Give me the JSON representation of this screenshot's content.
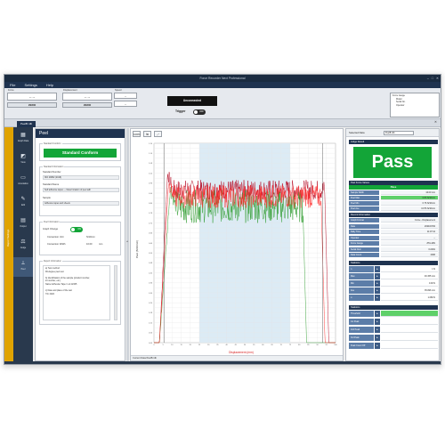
{
  "window": {
    "title": "Force Recorder Next Professional",
    "min": "–",
    "max": "□",
    "close": "✕"
  },
  "menu": [
    "File",
    "Settings",
    "Help"
  ],
  "ribbon": {
    "force": {
      "label": "Force",
      "value": "-- --",
      "zero": "ZERO"
    },
    "displacement": {
      "label": "Displacement",
      "value": "-- --",
      "zero": "ZERO"
    },
    "speed": {
      "label": "Speed",
      "value": "--",
      "unit": "--"
    },
    "connection": "Unconnected",
    "trigger": {
      "label": "Trigger",
      "state": "OFF"
    },
    "right_box": [
      "Force Gauge",
      "Model",
      "Serial No.",
      "Operator"
    ]
  },
  "tab": {
    "label": "PeelB.rdb",
    "close": "✕"
  },
  "leftbar_text": "Report Settings",
  "nav": [
    {
      "icon": "graph-data-icon",
      "glyph": "▦",
      "label": "Graph Data"
    },
    {
      "icon": "view-icon",
      "glyph": "◩",
      "label": "View"
    },
    {
      "icon": "annotation-icon",
      "glyph": "▭",
      "label": "Annotation"
    },
    {
      "icon": "edit-icon",
      "glyph": "✎",
      "label": "Edit"
    },
    {
      "icon": "output-icon",
      "glyph": "▤",
      "label": "Output"
    },
    {
      "icon": "judge-icon",
      "glyph": "⚖",
      "label": "Judge"
    },
    {
      "icon": "peel-icon",
      "glyph": "⟂",
      "label": "Peel"
    }
  ],
  "peel_panel": {
    "title": "Peel",
    "standard_conform": {
      "section": "Standard Conform",
      "button": "Standard Conform"
    },
    "standard_info": {
      "section": "Standard Information",
      "number_label": "Standard Number",
      "number_value": "ISO 29862 (2018)",
      "name_label": "Standard Name",
      "name_value": "Self adhesive tapes — Determination of peel adh",
      "sample_label": "Sample",
      "sample_value": "Adhesive tapes and sheets"
    },
    "peel_info": {
      "section": "Peel Information",
      "graph_change": "Graph Change",
      "graph_toggle": "ON",
      "conversion_unit_label": "Conversion Unit",
      "conversion_unit_value": "N/10mm",
      "conversion_width_label": "Conversion Width",
      "conversion_width_value": "10.00",
      "conversion_width_unit": "mm"
    },
    "report_info": {
      "section": "Report Information",
      "lines": [
        "a) Test method",
        "90-degree peel test",
        "",
        "b) Identification of the sample (product number,",
        "lot number, etc.)",
        "Name:Adhesive Tape / Lot:12345",
        "",
        "c) Date and place of the test",
        "7/1/ 2024"
      ]
    }
  },
  "chart_toolbar": [
    "100%",
    "⇆",
    "⤢"
  ],
  "chart_status": "Current Data:PeelB.rdb",
  "chart_data": {
    "type": "line",
    "title": "",
    "xlabel": "Displacement (mm)",
    "ylabel": "Peel (N/10mm)",
    "xlim": [
      0,
      100
    ],
    "ylim": [
      0,
      1.2
    ],
    "grid": true,
    "shaded_region": [
      25,
      75
    ],
    "cursor_x": [
      5.5,
      93
    ],
    "series": [
      {
        "color": "#b3001b",
        "role": "dark-red",
        "start": 3,
        "rise": 7.5,
        "peak": 1.02,
        "plateau": 0.92,
        "noise": 0.06,
        "end": 94
      },
      {
        "color": "#2a9a2a",
        "role": "green",
        "start": 3,
        "rise": 9,
        "peak": 0.93,
        "plateau": 0.82,
        "noise": 0.1,
        "end": 82
      },
      {
        "color": "#ff2a2a",
        "role": "red",
        "start": 3,
        "rise": 8,
        "peak": 0.96,
        "plateau": 0.88,
        "noise": 0.07,
        "end": 92
      }
    ]
  },
  "results": {
    "selected_data_label": "Selected Data",
    "selected_data_value": "PeelB.rdb",
    "judge_section": "Judge Result",
    "judge": "Pass",
    "peel_section": "Peel Force Values",
    "peel_status": "Pass",
    "peel_rows": [
      {
        "k": "Sample Width",
        "v": "10.00 mm",
        "green": false
      },
      {
        "k": "Peel Max",
        "v": "0.83 N/10mm",
        "green": true
      },
      {
        "k": "Peel Min",
        "v": "0.76 N/10mm",
        "green": false
      },
      {
        "k": "Peel Ave",
        "v": "0.076 N/10mm",
        "green": false
      }
    ],
    "record_section": "Record Information",
    "record_rows": [
      {
        "k": "Graph Format",
        "v": "Force - Displacement"
      },
      {
        "k": "Date",
        "v": "2024/07/02"
      },
      {
        "k": "Daily Time",
        "v": "11:07:41"
      },
      {
        "k": "Operator",
        "v": "--"
      },
      {
        "k": "Force Gauge",
        "v": "ZTA-20N"
      },
      {
        "k": "Serial Num",
        "v": "0-0001"
      },
      {
        "k": "Data Count",
        "v": "2006"
      }
    ],
    "stats_section": "Statistics",
    "stats_rows": [
      {
        "k": "n",
        "v": "1 N"
      },
      {
        "k": "Max",
        "v": "46.155 mm"
      },
      {
        "k": "Min",
        "v": "0.00 N"
      },
      {
        "k": "Ave",
        "v": "35.096 mm"
      },
      {
        "k": "σ",
        "v": "1.080 N"
      }
    ],
    "stats2_section": "Statistics",
    "stats2_rows": [
      {
        "k": "Threshold",
        "v": "",
        "green": true
      },
      {
        "k": "1st Peak",
        "v": "",
        "green": false
      },
      {
        "k": "2nd Peak",
        "v": "",
        "green": false
      },
      {
        "k": "3rd Peak",
        "v": "",
        "green": false
      },
      {
        "k": "Peak Count Off",
        "v": "",
        "green": false
      }
    ]
  }
}
